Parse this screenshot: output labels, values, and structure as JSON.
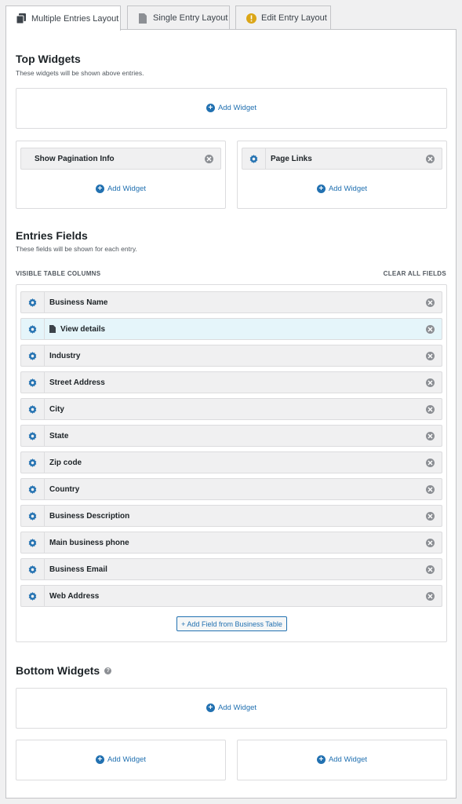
{
  "tabs": [
    {
      "label": "Multiple Entries Layout",
      "icon": "copy-icon",
      "active": true
    },
    {
      "label": "Single Entry Layout",
      "icon": "document-icon",
      "active": false
    },
    {
      "label": "Edit Entry Layout",
      "icon": "warning-icon",
      "active": false
    }
  ],
  "top_widgets": {
    "title": "Top Widgets",
    "subtitle": "These widgets will be shown above entries.",
    "add_widget": "Add Widget",
    "left_item": "Show Pagination Info",
    "right_item": "Page Links"
  },
  "entries_fields": {
    "title": "Entries Fields",
    "subtitle": "These fields will be shown for each entry.",
    "visible_columns_label": "VISIBLE TABLE COLUMNS",
    "clear_all_label": "CLEAR ALL FIELDS",
    "fields": [
      "Business Name",
      "View details",
      "Industry",
      "Street Address",
      "City",
      "State",
      "Zip code",
      "Country",
      "Business Description",
      "Main business phone",
      "Business Email",
      "Web Address"
    ],
    "add_field_label": "+ Add Field from Business Table"
  },
  "bottom_widgets": {
    "title": "Bottom Widgets",
    "help": "?",
    "add_widget": "Add Widget"
  },
  "colors": {
    "accent": "#2271b1",
    "highlight_row": "#e5f5fa",
    "warning": "#dba617"
  }
}
